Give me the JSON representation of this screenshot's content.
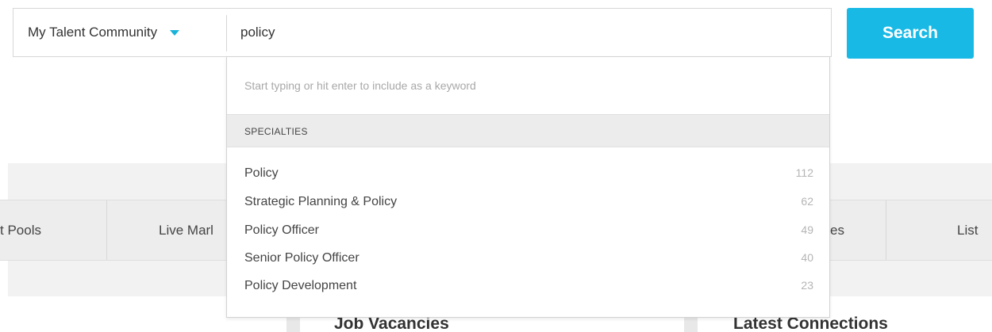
{
  "search": {
    "scope_label": "My Talent Community",
    "query": "policy",
    "button_label": "Search"
  },
  "dropdown": {
    "hint": "Start typing or hit enter to include as a keyword",
    "section_title": "SPECIALTIES",
    "options": [
      {
        "label": "Policy",
        "count": "112"
      },
      {
        "label": "Strategic Planning & Policy",
        "count": "62"
      },
      {
        "label": "Policy Officer",
        "count": "49"
      },
      {
        "label": "Senior Policy Officer",
        "count": "40"
      },
      {
        "label": "Policy Development",
        "count": "23"
      }
    ]
  },
  "background": {
    "tabs": [
      "t Pools",
      "Live Marl",
      "es",
      "List"
    ],
    "columns": [
      "Job Vacancies",
      "Latest Connections"
    ]
  },
  "colors": {
    "accent": "#19b9e6"
  }
}
